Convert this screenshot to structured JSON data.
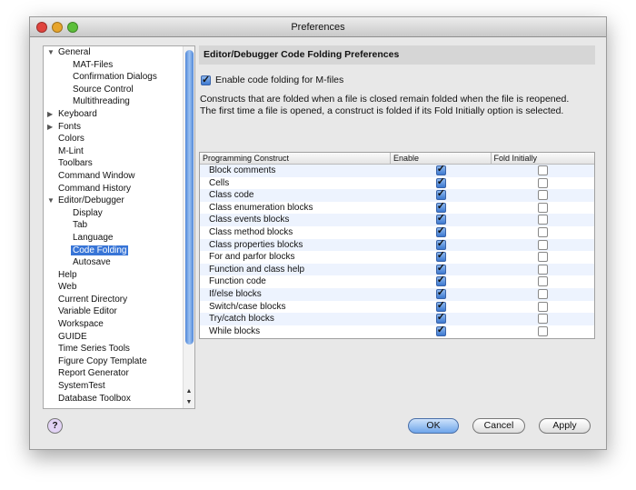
{
  "window": {
    "title": "Preferences"
  },
  "tree": {
    "items": [
      {
        "label": "General",
        "level": 0,
        "expander": "expanded"
      },
      {
        "label": "MAT-Files",
        "level": 2
      },
      {
        "label": "Confirmation Dialogs",
        "level": 2
      },
      {
        "label": "Source Control",
        "level": 2
      },
      {
        "label": "Multithreading",
        "level": 2
      },
      {
        "label": "Keyboard",
        "level": 0,
        "expander": "collapsed"
      },
      {
        "label": "Fonts",
        "level": 0,
        "expander": "collapsed"
      },
      {
        "label": "Colors",
        "level": 0
      },
      {
        "label": "M-Lint",
        "level": 0
      },
      {
        "label": "Toolbars",
        "level": 0
      },
      {
        "label": "Command Window",
        "level": 0
      },
      {
        "label": "Command History",
        "level": 0
      },
      {
        "label": "Editor/Debugger",
        "level": 0,
        "expander": "expanded"
      },
      {
        "label": "Display",
        "level": 1
      },
      {
        "label": "Tab",
        "level": 1
      },
      {
        "label": "Language",
        "level": 1
      },
      {
        "label": "Code Folding",
        "level": 1,
        "selected": true
      },
      {
        "label": "Autosave",
        "level": 1
      },
      {
        "label": "Help",
        "level": 0
      },
      {
        "label": "Web",
        "level": 0
      },
      {
        "label": "Current Directory",
        "level": 0
      },
      {
        "label": "Variable Editor",
        "level": 0
      },
      {
        "label": "Workspace",
        "level": 0
      },
      {
        "label": "GUIDE",
        "level": 0
      },
      {
        "label": "Time Series Tools",
        "level": 0
      },
      {
        "label": "Figure Copy Template",
        "level": 0
      },
      {
        "label": "Report Generator",
        "level": 0
      },
      {
        "label": "SystemTest",
        "level": 0
      },
      {
        "label": "Database Toolbox",
        "level": 0
      }
    ]
  },
  "panel": {
    "title": "Editor/Debugger Code Folding Preferences",
    "enable_label": "Enable code folding for M-files",
    "enable_checked": true,
    "desc1": "Constructs that are folded when a file is closed remain folded when the file is reopened.",
    "desc2": "The first time a file is opened, a construct is folded if its Fold Initially option is selected.",
    "columns": [
      "Programming Construct",
      "Enable",
      "Fold Initially"
    ],
    "rows": [
      {
        "name": "Block comments",
        "enable": true,
        "fold": false
      },
      {
        "name": "Cells",
        "enable": true,
        "fold": false
      },
      {
        "name": "Class code",
        "enable": true,
        "fold": false
      },
      {
        "name": "Class enumeration blocks",
        "enable": true,
        "fold": false
      },
      {
        "name": "Class events blocks",
        "enable": true,
        "fold": false
      },
      {
        "name": "Class method blocks",
        "enable": true,
        "fold": false
      },
      {
        "name": "Class properties blocks",
        "enable": true,
        "fold": false
      },
      {
        "name": "For and parfor blocks",
        "enable": true,
        "fold": false
      },
      {
        "name": "Function and class help",
        "enable": true,
        "fold": false
      },
      {
        "name": "Function code",
        "enable": true,
        "fold": false
      },
      {
        "name": "If/else blocks",
        "enable": true,
        "fold": false
      },
      {
        "name": "Switch/case blocks",
        "enable": true,
        "fold": false
      },
      {
        "name": "Try/catch blocks",
        "enable": true,
        "fold": false
      },
      {
        "name": "While blocks",
        "enable": true,
        "fold": false
      }
    ]
  },
  "buttons": {
    "help": "?",
    "ok": "OK",
    "cancel": "Cancel",
    "apply": "Apply"
  }
}
